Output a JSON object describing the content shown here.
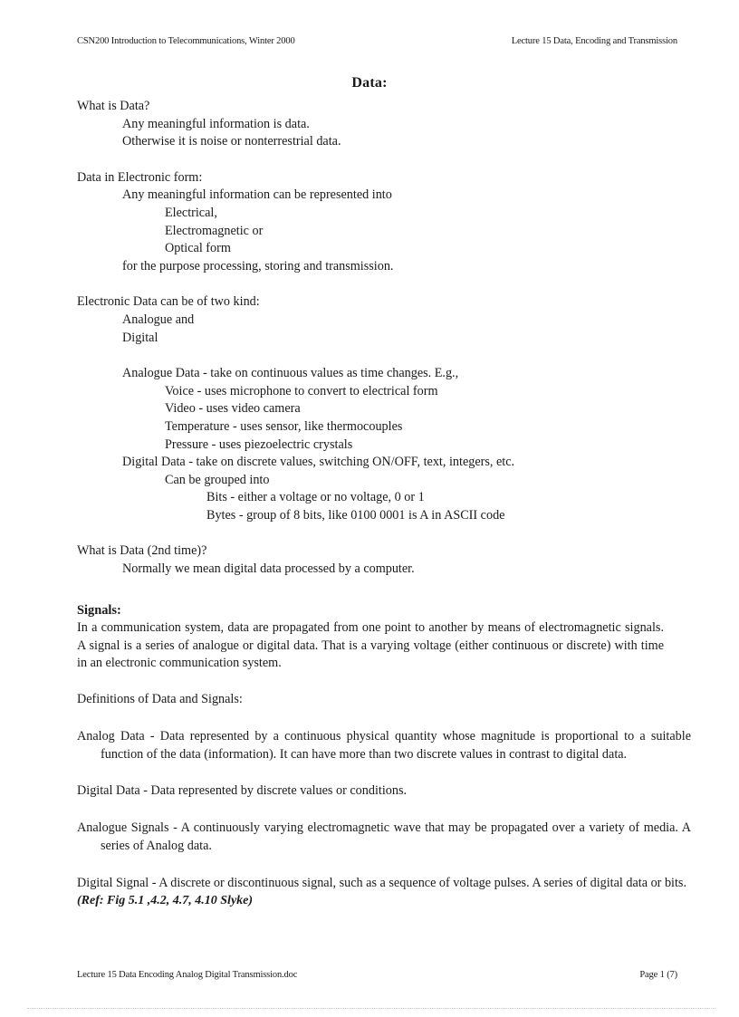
{
  "header": {
    "left": "CSN200 Introduction to Telecommunications, Winter 2000",
    "right": "Lecture 15  Data, Encoding and Transmission"
  },
  "title": "Data:",
  "sections": {
    "what_is_data": {
      "heading": "What is Data?",
      "lines": [
        "Any meaningful   information   is data.",
        "Otherwise  it  is  noise  or  nonterrestrial   data."
      ]
    },
    "electronic_form": {
      "heading": "Data in Electronic   form:",
      "intro": "Any meaningful   information   can be represented into",
      "forms": [
        "Electrical,",
        "Electromagnetic    or",
        "Optical form"
      ],
      "closing": "for the purpose processing,   storing  and transmission."
    },
    "two_kinds": {
      "heading": "Electronic   Data can be of two kind:",
      "kinds": [
        "Analogue   and",
        "Digital"
      ],
      "analogue": {
        "lead": "Analogue   Data - take on continuous   values  as time   changes.  E.g.,",
        "examples": [
          "Voice  -  uses microphone   to convert  to electrical   form",
          "Video  - uses video  camera",
          "Temperature   - uses sensor,  like  thermocouples",
          "Pressure  - uses piezoelectric    crystals"
        ]
      },
      "digital": {
        "lead": "Digital   Data - take on discrete values,   switching   ON/OFF, text,  integers,   etc.",
        "grouped": "Can be grouped into",
        "items": [
          "Bits  - either  a voltage   or no voltage,   0 or 1",
          "Bytes  - group  of 8 bits,  like  0100 0001 is  A in  ASCII code"
        ]
      }
    },
    "what_is_data_2": {
      "heading": "What is Data (2nd time)?",
      "line": "Normally   we mean  digital   data processed by a computer."
    },
    "signals": {
      "heading": "Signals:",
      "paragraph": "In a communication    system,  data are propagated from  one point  to another  by means of electromagnetic    signals.   A signal   is a series  of analogue   or digital   data. That is a varying   voltage (either  continuous   or discrete)  with  time  in an electronic   communication    system.",
      "definitions_heading": "Definitions    of Data and Signals:",
      "definitions": [
        "Analog  Data - Data represented  by a continuous   physical   quantity   whose magnitude   is proportional  to a suitable   function   of the data (information).   It can have more than  two discrete  values  in contrast  to digital   data.",
        "Digital   Data - Data represented by discrete  values  or conditions.",
        "Analogue   Signals   - A continuously   varying  electromagnetic    wave that may be propagated over a variety  of media.  A series of Analog  data.",
        "Digital   Signal   - A discrete or discontinuous    signal,   such as a sequence of voltage  pulses.  A series  of digital   data or bits."
      ],
      "reference": "(Ref:  Fig 5.1 ,4.2,  4.7,  4.10 Slyke)"
    }
  },
  "footer": {
    "left": "Lecture  15  Data  Encoding  Analog  Digital  Transmission.doc",
    "right": "Page 1 (7)"
  }
}
